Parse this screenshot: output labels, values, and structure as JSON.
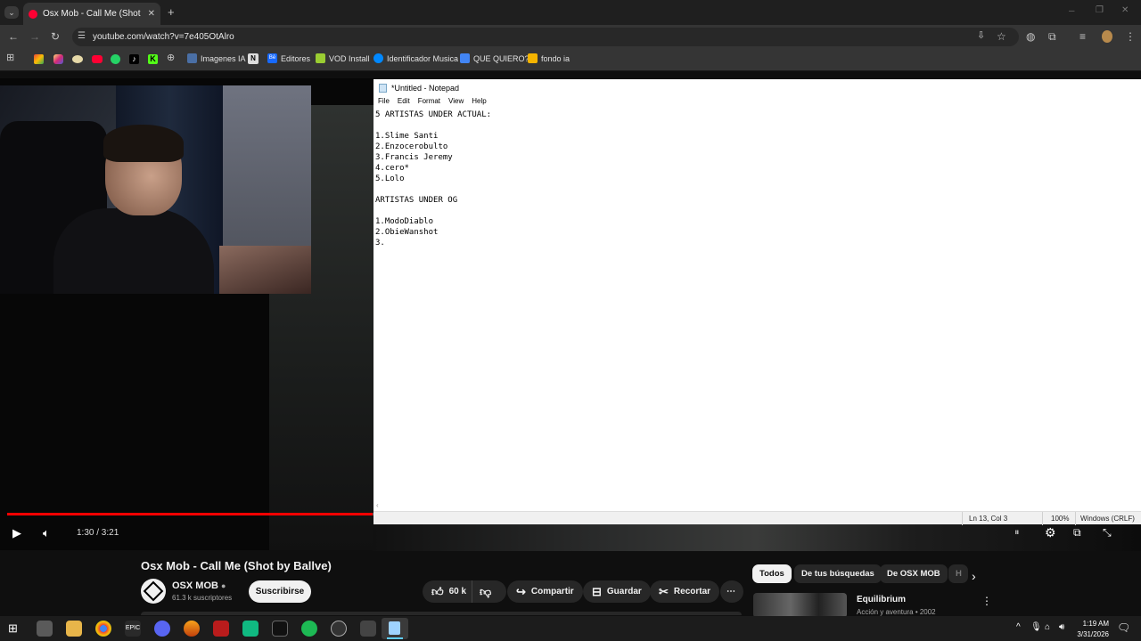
{
  "browser": {
    "tab_title": "Osx Mob - Call Me (Shot by Ballve)",
    "url": "youtube.com/watch?v=7e405OtAlro",
    "bookmarks": [
      {
        "label": "Imagenes IA",
        "icon": "bookmark-icon"
      },
      {
        "label": "Editores",
        "icon": "behance-icon"
      },
      {
        "label": "VOD Install",
        "icon": "bookmark-icon"
      },
      {
        "label": "Identificador Musica",
        "icon": "shazam-icon"
      },
      {
        "label": "QUE QUIERO?",
        "icon": "docs-icon"
      },
      {
        "label": "fondo ia",
        "icon": "folder-icon"
      }
    ]
  },
  "notepad": {
    "title": "*Untitled - Notepad",
    "menu": [
      "File",
      "Edit",
      "Format",
      "View",
      "Help"
    ],
    "content": "5 ARTISTAS UNDER ACTUAL:\n\n1.Slime Santi\n2.Enzocerobulto\n3.Francis Jeremy\n4.cero*\n5.Lolo\n\nARTISTAS UNDER OG\n\n1.ModoDiablo\n2.ObieWanshot\n3.",
    "status_position": "Ln 13, Col 3",
    "status_zoom": "100%",
    "status_encoding": "Windows (CRLF)"
  },
  "player": {
    "time": "1:30 / 3:21",
    "progress_fraction": 0.47
  },
  "video": {
    "title": "Osx Mob - Call Me (Shot by Ballve)",
    "channel": "OSX MOB",
    "subscribers": "61.3 k suscriptores",
    "subscribe_label": "Suscribirse",
    "likes": "60 k",
    "share_label": "Compartir",
    "save_label": "Guardar",
    "clip_label": "Recortar"
  },
  "chips": [
    "Todos",
    "De tus búsquedas",
    "De OSX MOB",
    "H"
  ],
  "recommendation": {
    "title": "Equilibrium",
    "subtitle": "Acción y aventura • 2002"
  },
  "taskbar": {
    "time": "1:19 AM",
    "date": "3/31/2026"
  },
  "colors": {
    "youtube_red": "#ff0033",
    "progress_red": "#ff0000",
    "page_bg": "#0f0f0f",
    "chrome_bg": "#353535"
  }
}
